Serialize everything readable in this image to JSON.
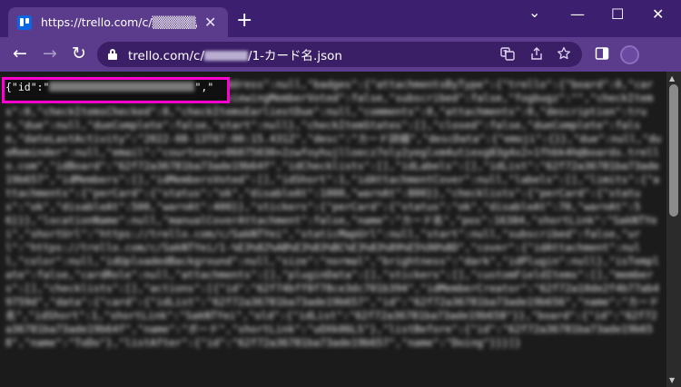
{
  "browser": {
    "tab": {
      "title": "https://trello.com/c/▒▒▒▒▒/1-",
      "close_glyph": "✕"
    },
    "new_tab_glyph": "+",
    "window": {
      "minimize": "—",
      "maximize": "☐",
      "close": "✕",
      "tab_search": "⌄"
    },
    "nav": {
      "back": "←",
      "forward": "→",
      "reload": "↻"
    },
    "address": {
      "prefix": "trello.com/c/",
      "suffix": "/1-カード名.json"
    },
    "icons": {
      "translate": "translate-icon",
      "share": "share-icon",
      "bookmark": "star-icon",
      "side_panel": "side-panel-icon",
      "profile": "profile-avatar"
    }
  },
  "json_view": {
    "head_prefix": "{\"id\":\"",
    "head_suffix": "\",\"",
    "body": "{\"id\":\"62f72a36781ba73ade19b656\",\"address\":null,\"badges\":{\"attachmentsByType\":{\"trello\":{\"board\":0,\"card\":0}},\"location\":false,\"votes\":0,\"viewingMemberVoted\":false,\"subscribed\":false,\"fogbugz\":\"\",\"checkItems\":0,\"checkItemsChecked\":0,\"checkItemsEarliestDue\":null,\"comments\":0,\"attachments\":0,\"description\":true,\"due\":null,\"dueComplete\":false,\"start\":null},\"checkItemStates\":[],\"closed\":false,\"dueComplete\":false,\"dateLastActivity\":\"2022-08-13T07:00:15.431Z\",\"desc\":\"カード詳細\",\"descData\":{\"emoji\":{}},\"due\":null,\"dueReminder\":null,\"email\":\"courteney+06075030+2zwfoyhujlloecz7oly2yeglxm4utiexg83g4x2+1fhbk4h@boards.trello.com\",\"idBoard\":\"62f72a36781ba73ade19b64f\",\"idChecklists\":[],\"idLabels\":[],\"idList\":\"62f72a36781ba73ade19b657\",\"idMembers\":[],\"idMembersVoted\":[],\"idShort\":1,\"idAttachmentCover\":null,\"labels\":[],\"limits\":{\"attachments\":{\"perCard\":{\"status\":\"ok\",\"disableAt\":1000,\"warnAt\":800}},\"checklists\":{\"perCard\":{\"status\":\"ok\",\"disableAt\":500,\"warnAt\":400}},\"stickers\":{\"perCard\":{\"status\":\"ok\",\"disableAt\":70,\"warnAt\":56}}},\"locationName\":null,\"manualCoverAttachment\":false,\"name\":\"カード名\",\"pos\":16384,\"shortLink\":\"SakNTYei\",\"shortUrl\":\"https://trello.com/c/SakNTYei\",\"staticMapUrl\":null,\"start\":null,\"subscribed\":false,\"url\":\"https://trello.com/c/SakNTYei/1-%E3%82%AB%E3%83%BC%E3%83%89%E5%90%8D\",\"cover\":{\"idAttachment\":null,\"color\":null,\"idUploadedBackground\":null,\"size\":\"normal\",\"brightness\":\"dark\",\"idPlugin\":null},\"isTemplate\":false,\"cardRole\":null,\"attachments\":[],\"pluginData\":[],\"stickers\":[],\"customFieldItems\":[],\"members\":[],\"checklists\":[],\"actions\":[{\"id\":\"62f74bff8f78ce3dc701b394\",\"idMemberCreator\":\"62f72a10de2f4b77ab49759d\",\"data\":{\"card\":{\"idList\":\"62f72a36781ba73ade19b657\",\"id\":\"62f72a36781ba73ade19b656\",\"name\":\"カード名\",\"idShort\":1,\"shortLink\":\"SakNTYei\",\"old\":{\"idList\":\"62f72a36781ba73ade19b658\"}},\"board\":{\"id\":\"62f72a36781ba73ade19b64f\",\"name\":\"ボード\",\"shortLink\":\"uOXk06LS\"},\"listBefore\":{\"id\":\"62f72a36781ba73ade19b658\",\"name\":\"ToDo\"},\"listAfter\":{\"id\":\"62f72a36781ba73ade19b657\",\"name\":\"Doing\"}}}]}"
  },
  "colors": {
    "highlight": "#ff00d0",
    "tabstrip": "#3c1f6e",
    "toolbar": "#5a3b8c"
  }
}
